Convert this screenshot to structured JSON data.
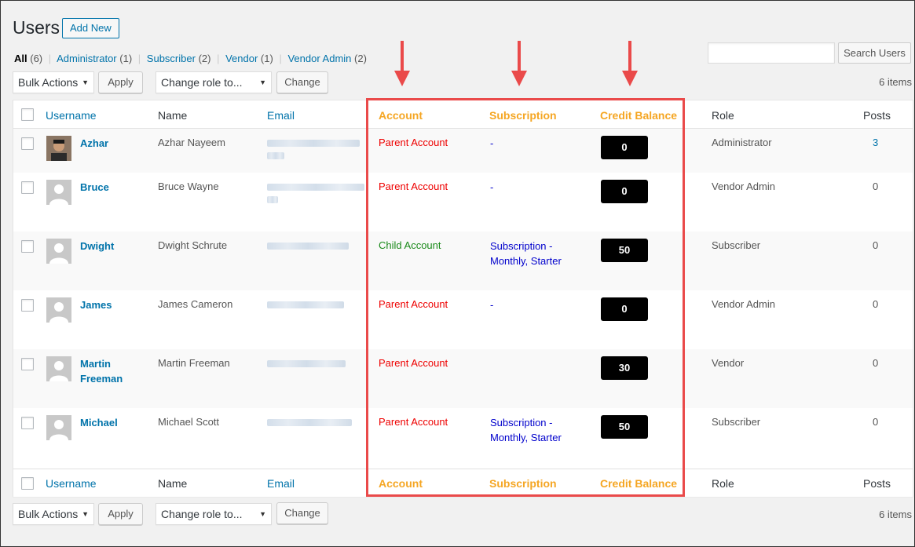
{
  "page": {
    "title": "Users",
    "add_new": "Add New"
  },
  "filters": [
    {
      "label": "All",
      "count": "(6)",
      "current": true
    },
    {
      "label": "Administrator",
      "count": "(1)"
    },
    {
      "label": "Subscriber",
      "count": "(2)"
    },
    {
      "label": "Vendor",
      "count": "(1)"
    },
    {
      "label": "Vendor Admin",
      "count": "(2)"
    }
  ],
  "search": {
    "button": "Search Users",
    "value": ""
  },
  "tablenav": {
    "bulk_actions": "Bulk Actions",
    "apply": "Apply",
    "change_role": "Change role to...",
    "change": "Change",
    "items": "6 items"
  },
  "columns": {
    "username": "Username",
    "name": "Name",
    "email": "Email",
    "account": "Account",
    "subscription": "Subscription",
    "credit": "Credit Balance",
    "role": "Role",
    "posts": "Posts"
  },
  "users": [
    {
      "username": "Azhar",
      "name": "Azhar Nayeem",
      "account": "Parent Account",
      "account_type": "parent",
      "subscription": "-",
      "credit": "0",
      "role": "Administrator",
      "posts": "3"
    },
    {
      "username": "Bruce",
      "name": "Bruce Wayne",
      "account": "Parent Account",
      "account_type": "parent",
      "subscription": "-",
      "credit": "0",
      "role": "Vendor Admin",
      "posts": "0"
    },
    {
      "username": "Dwight",
      "name": "Dwight Schrute",
      "account": "Child Account",
      "account_type": "child",
      "subscription": "Subscription - Monthly, Starter",
      "credit": "50",
      "role": "Subscriber",
      "posts": "0"
    },
    {
      "username": "James",
      "name": "James Cameron",
      "account": "Parent Account",
      "account_type": "parent",
      "subscription": "-",
      "credit": "0",
      "role": "Vendor Admin",
      "posts": "0"
    },
    {
      "username": "Martin Freeman",
      "name": "Martin Freeman",
      "account": "Parent Account",
      "account_type": "parent",
      "subscription": "",
      "credit": "30",
      "role": "Vendor",
      "posts": "0"
    },
    {
      "username": "Michael",
      "name": "Michael Scott",
      "account": "Parent Account",
      "account_type": "parent",
      "subscription": "Subscription - Monthly, Starter",
      "credit": "50",
      "role": "Subscriber",
      "posts": "0"
    }
  ],
  "colors": {
    "accent": "#0073aa",
    "highlight": "#ea4a4a",
    "header_orange": "#f5a623",
    "parent_account": "#ee0000",
    "child_account": "#1b8a1b",
    "subscription": "#0000cc",
    "credit_badge": "#000000"
  },
  "icons": [
    "down-arrow-icon",
    "avatar-placeholder-icon",
    "caret-down-icon"
  ]
}
